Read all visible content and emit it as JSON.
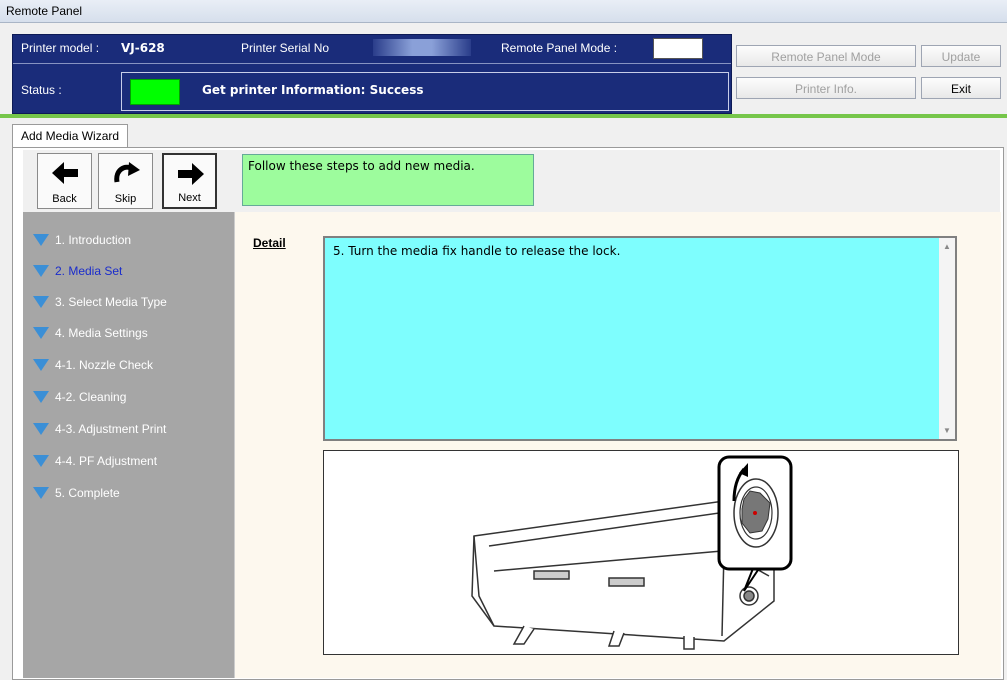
{
  "window": {
    "title": "Remote Panel"
  },
  "header": {
    "model_label": "Printer model :",
    "model_value": "VJ-628",
    "serial_label": "Printer Serial No",
    "mode_label": "Remote Panel Mode :",
    "status_label": "Status :",
    "status_text": "Get printer Information: Success"
  },
  "buttons": {
    "remote_mode": "Remote Panel Mode",
    "update": "Update",
    "printer_info": "Printer Info.",
    "exit": "Exit"
  },
  "tab": {
    "label": "Add Media Wizard"
  },
  "toolbar": {
    "back": "Back",
    "skip": "Skip",
    "next": "Next"
  },
  "message": "Follow these steps to add new media.",
  "steps": [
    "1. Introduction",
    "2. Media Set",
    "3. Select Media Type",
    "4. Media Settings",
    "4-1. Nozzle Check",
    "4-2. Cleaning",
    "4-3. Adjustment Print",
    "4-4. PF Adjustment",
    "5. Complete"
  ],
  "active_step_index": 1,
  "detail": {
    "label": "Detail",
    "text": "5. Turn the media fix handle to release the lock."
  },
  "colors": {
    "header_bg": "#1a2c7a",
    "status_led": "#00ff00",
    "message_bg": "#9dfc9d",
    "detail_bg": "#7efefe",
    "active_step": "#1a2ccc"
  }
}
